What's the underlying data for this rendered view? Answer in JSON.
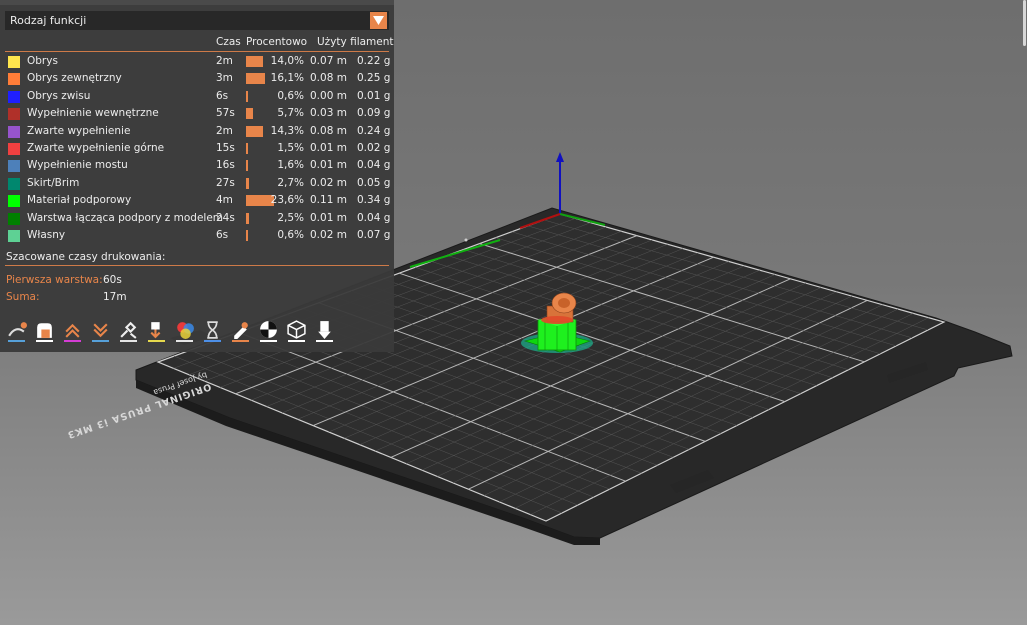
{
  "legend": {
    "combo_value": "Rodzaj funkcji",
    "headers": {
      "time": "Czas",
      "percent": "Procentowo",
      "filament": "Użyty filament"
    },
    "rows": [
      {
        "name": "Obrys",
        "color": "#FFE64D",
        "time": "2m",
        "pct": 14.0,
        "pct_text": "14,0%",
        "len": "0.07 m",
        "wt": "0.22 g"
      },
      {
        "name": "Obrys zewnętrzny",
        "color": "#FF7D38",
        "time": "3m",
        "pct": 16.1,
        "pct_text": "16,1%",
        "len": "0.08 m",
        "wt": "0.25 g"
      },
      {
        "name": "Obrys zwisu",
        "color": "#1F1FFF",
        "time": "6s",
        "pct": 0.6,
        "pct_text": "0,6%",
        "len": "0.00 m",
        "wt": "0.01 g"
      },
      {
        "name": "Wypełnienie wewnętrzne",
        "color": "#B03029",
        "time": "57s",
        "pct": 5.7,
        "pct_text": "5,7%",
        "len": "0.03 m",
        "wt": "0.09 g"
      },
      {
        "name": "Zwarte wypełnienie",
        "color": "#9654CC",
        "time": "2m",
        "pct": 14.3,
        "pct_text": "14,3%",
        "len": "0.08 m",
        "wt": "0.24 g"
      },
      {
        "name": "Zwarte wypełnienie górne",
        "color": "#F04040",
        "time": "15s",
        "pct": 1.5,
        "pct_text": "1,5%",
        "len": "0.01 m",
        "wt": "0.02 g"
      },
      {
        "name": "Wypełnienie mostu",
        "color": "#4D80BA",
        "time": "16s",
        "pct": 1.6,
        "pct_text": "1,6%",
        "len": "0.01 m",
        "wt": "0.04 g"
      },
      {
        "name": "Skirt/Brim",
        "color": "#00876E",
        "time": "27s",
        "pct": 2.7,
        "pct_text": "2,7%",
        "len": "0.02 m",
        "wt": "0.05 g"
      },
      {
        "name": "Materiał podporowy",
        "color": "#00FF00",
        "time": "4m",
        "pct": 23.6,
        "pct_text": "23,6%",
        "len": "0.11 m",
        "wt": "0.34 g"
      },
      {
        "name": "Warstwa łącząca podpory z modelem",
        "color": "#008000",
        "time": "24s",
        "pct": 2.5,
        "pct_text": "2,5%",
        "len": "0.01 m",
        "wt": "0.04 g"
      },
      {
        "name": "Własny",
        "color": "#5ED194",
        "time": "6s",
        "pct": 0.6,
        "pct_text": "0,6%",
        "len": "0.02 m",
        "wt": "0.07 g"
      }
    ],
    "estimate": {
      "title": "Szacowane czasy drukowania:",
      "first_layer_label": "Pierwsza warstwa:",
      "first_layer_value": "60s",
      "total_label": "Suma:",
      "total_value": "17m"
    }
  },
  "toolbar_icons": [
    {
      "name": "travel-icon",
      "color": "#56A0D9"
    },
    {
      "name": "wipe-icon",
      "color": "#FFFFFF"
    },
    {
      "name": "retractions-icon",
      "color": "#D43DD4"
    },
    {
      "name": "deretractions-icon",
      "color": "#56A0D9"
    },
    {
      "name": "seams-icon",
      "color": "#E6E6E6"
    },
    {
      "name": "tool-changes-icon",
      "color": "#E6D94D"
    },
    {
      "name": "color-changes-icon",
      "color": "#E6E6E6"
    },
    {
      "name": "pause-prints-icon",
      "color": "#4D8FE6"
    },
    {
      "name": "custom-gcodes-icon",
      "color": "#E8854A"
    },
    {
      "name": "center-of-gravity-icon",
      "color": "#FFFFFF"
    },
    {
      "name": "shells-icon",
      "color": "#FFFFFF"
    },
    {
      "name": "tool-marker-icon",
      "color": "#FFFFFF"
    }
  ],
  "bed": {
    "label_line1": "ORIGINAL PRUSA i3 MK3",
    "label_line2": "by Josef Prusa"
  }
}
